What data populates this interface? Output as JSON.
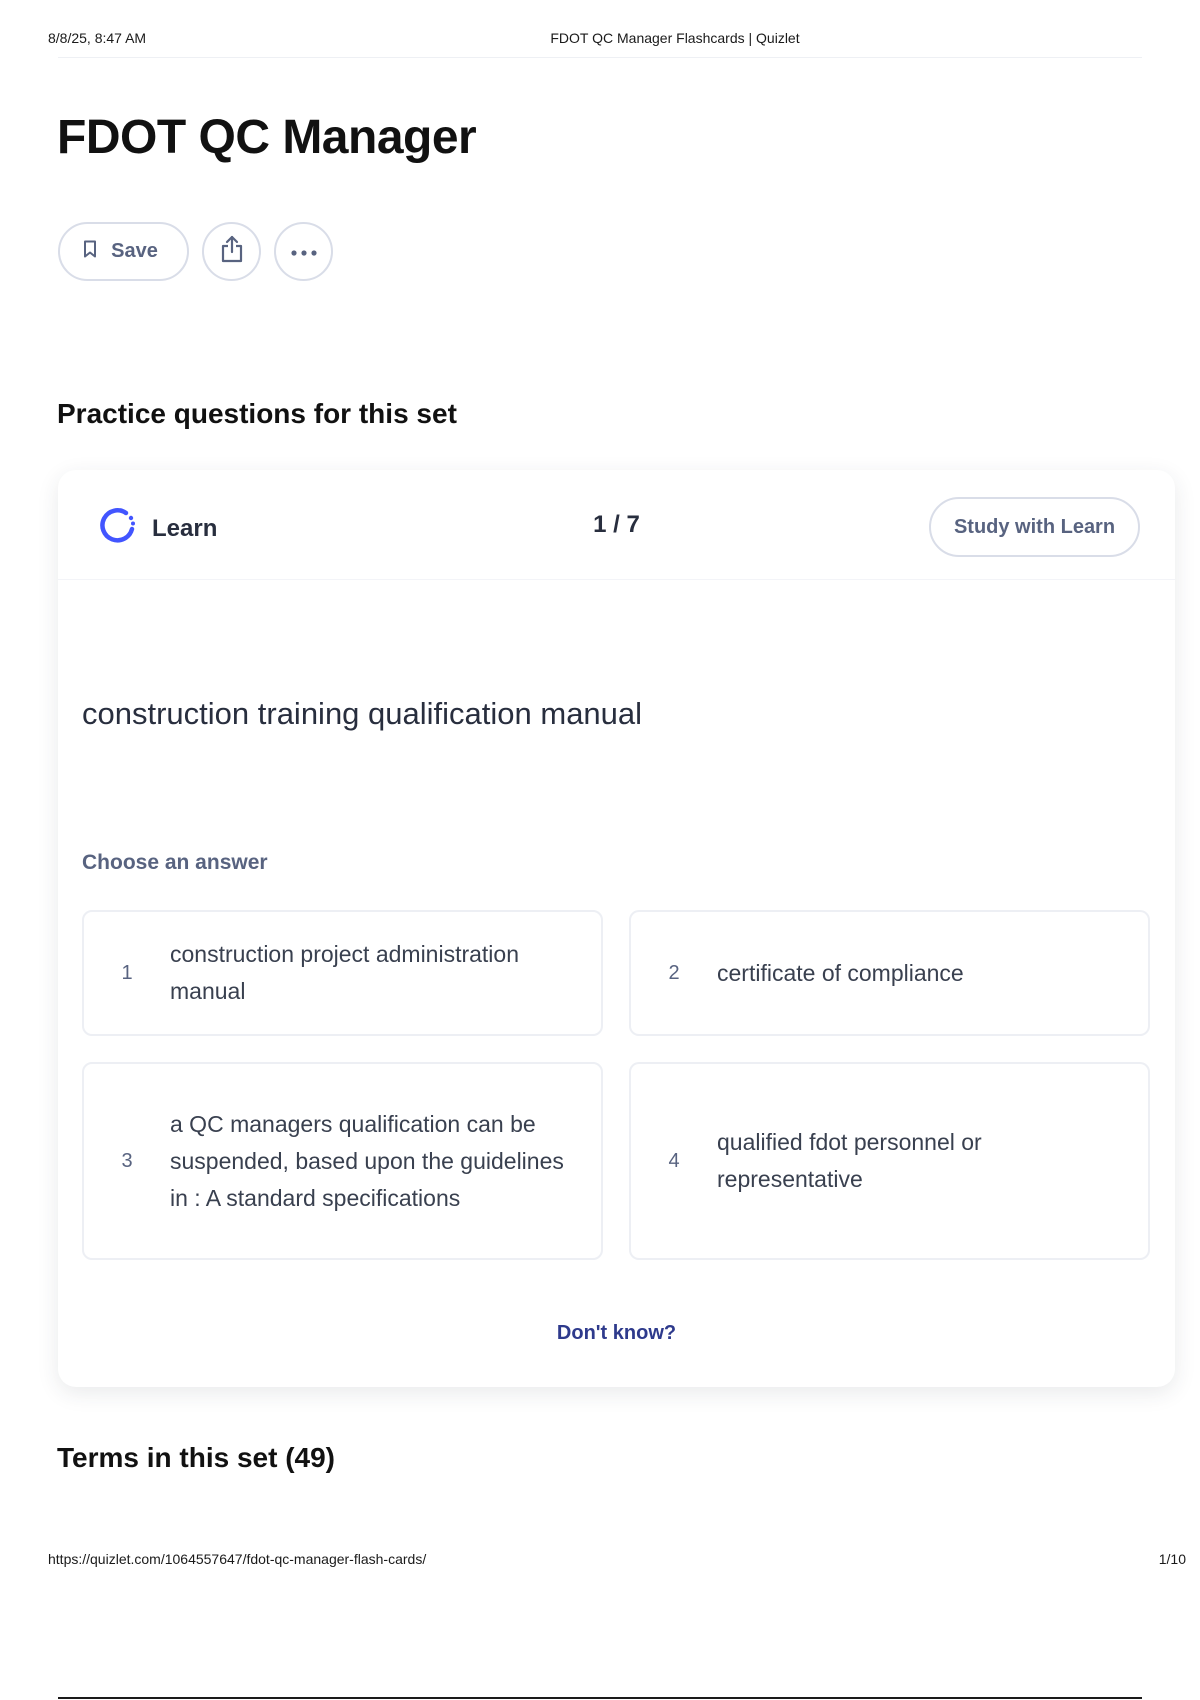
{
  "print_header": {
    "date": "8/8/25, 8:47 AM",
    "title": "FDOT QC Manager Flashcards | Quizlet"
  },
  "set": {
    "title": "FDOT QC Manager"
  },
  "actions": {
    "save_label": "Save",
    "share_icon": "share-icon",
    "more_icon": "more-icon"
  },
  "practice": {
    "heading": "Practice questions for this set",
    "mode_label": "Learn",
    "progress": "1 / 7",
    "study_button": "Study with Learn",
    "term": "construction training qualification manual",
    "choose_label": "Choose an answer",
    "options": [
      {
        "num": "1",
        "text": "construction project administration manual"
      },
      {
        "num": "2",
        "text": "certificate of compliance"
      },
      {
        "num": "3",
        "text": "a QC managers qualification can be suspended, based upon the guidelines in : A standard specifications"
      },
      {
        "num": "4",
        "text": "qualified fdot personnel or representative"
      }
    ],
    "dont_know": "Don't know?"
  },
  "terms": {
    "heading": "Terms in this set (49)"
  },
  "print_footer": {
    "url": "https://quizlet.com/1064557647/fdot-qc-manager-flash-cards/",
    "page": "1/10"
  },
  "colors": {
    "accent": "#4255ff",
    "muted_text": "#586380",
    "link": "#2e3a8c"
  }
}
